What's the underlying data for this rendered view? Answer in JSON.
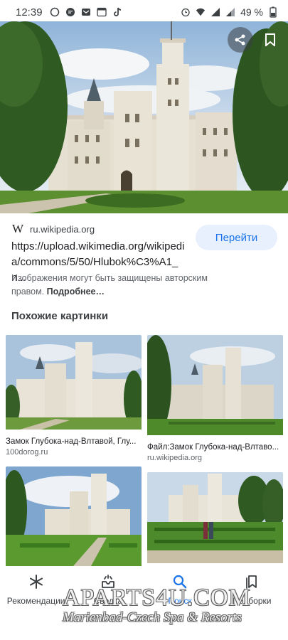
{
  "status_bar": {
    "time": "12:39",
    "battery": "49 %"
  },
  "source": {
    "logo": "W",
    "domain": "ru.wikipedia.org"
  },
  "goto_button": "Перейти",
  "url": "https://upload.wikimedia.org/wikipedia/commons/5/50/Hlubok%C3%A1_n...",
  "disclaimer": {
    "text": "Изображения могут быть защищены авторским правом. ",
    "more": "Подробнее…"
  },
  "similar": {
    "title": "Похожие картинки",
    "items": [
      {
        "title": "Замок Глубока-над-Влтавой, Глу...",
        "source": "100dorog.ru"
      },
      {
        "title": "Файл:Замок Глубока-над-Влтаво...",
        "source": "ru.wikipedia.org"
      },
      {
        "title": "",
        "source": ""
      },
      {
        "title": "",
        "source": ""
      }
    ]
  },
  "bottom_nav": [
    {
      "label": "Рекомендации",
      "icon": "asterisk-icon"
    },
    {
      "label": "Сводка",
      "icon": "tray-icon"
    },
    {
      "label": "Поиск",
      "icon": "search-icon"
    },
    {
      "label": "Подборки",
      "icon": "collections-icon"
    }
  ],
  "watermark": {
    "line1": "APARTS4U.COM",
    "line2": "Marienbad-Czech Spa & Resorts"
  },
  "colors": {
    "accent": "#1a73e8",
    "button_bg": "#e8f0fe",
    "text_secondary": "#5f6368"
  }
}
